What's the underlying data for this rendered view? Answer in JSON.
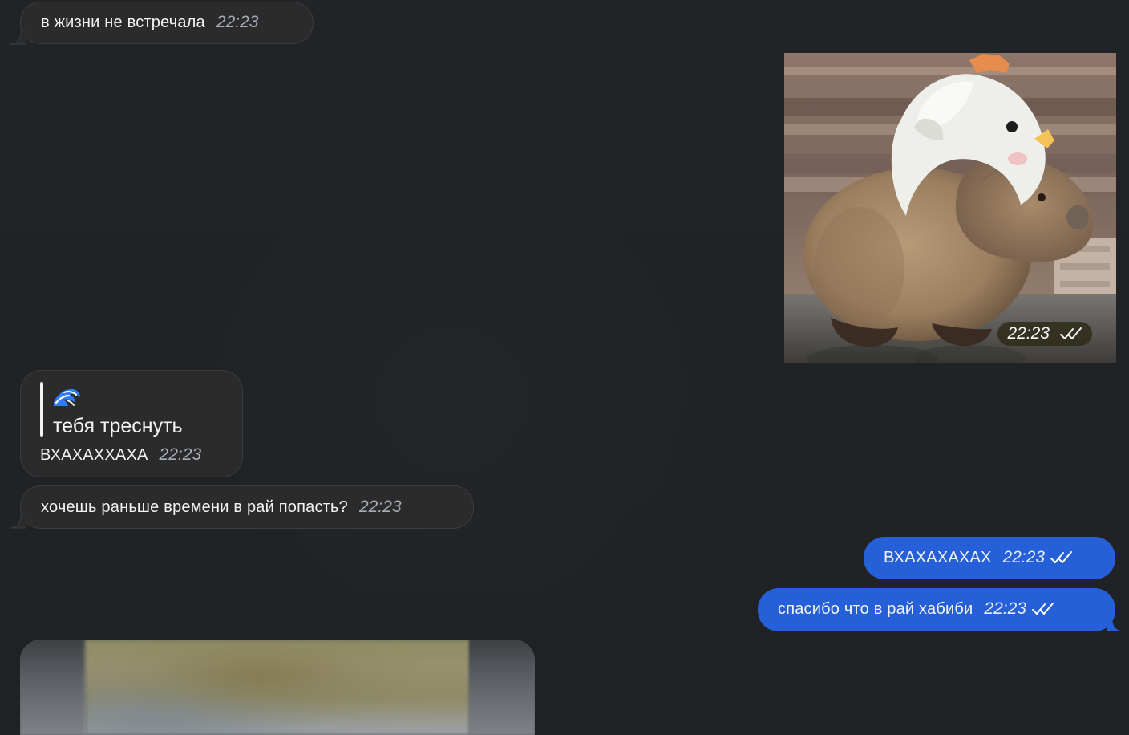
{
  "messages": [
    {
      "text": "в жизни не встречала",
      "time": "22:23"
    },
    {
      "photo_time": "22:23"
    },
    {
      "reply_emoji": "🌊",
      "quote_text": "тебя треснуть",
      "text": "ВХАХАХХАХА",
      "time": "22:23"
    },
    {
      "text": "хочешь раньше времени в рай попасть?",
      "time": "22:23"
    },
    {
      "text": "ВХАХАХАХАХ",
      "time": "22:23"
    },
    {
      "text": "спасибо что в рай хабиби",
      "time": "22:23"
    }
  ],
  "colors": {
    "chat_background": "#202326",
    "incoming_bubble": "#2b2b2c",
    "outgoing_bubble": "#2560d8",
    "incoming_time": "#a6acb8"
  },
  "icons": {
    "read_status": "double-check-icon",
    "reply_emoji": "wave-emoji-icon"
  }
}
